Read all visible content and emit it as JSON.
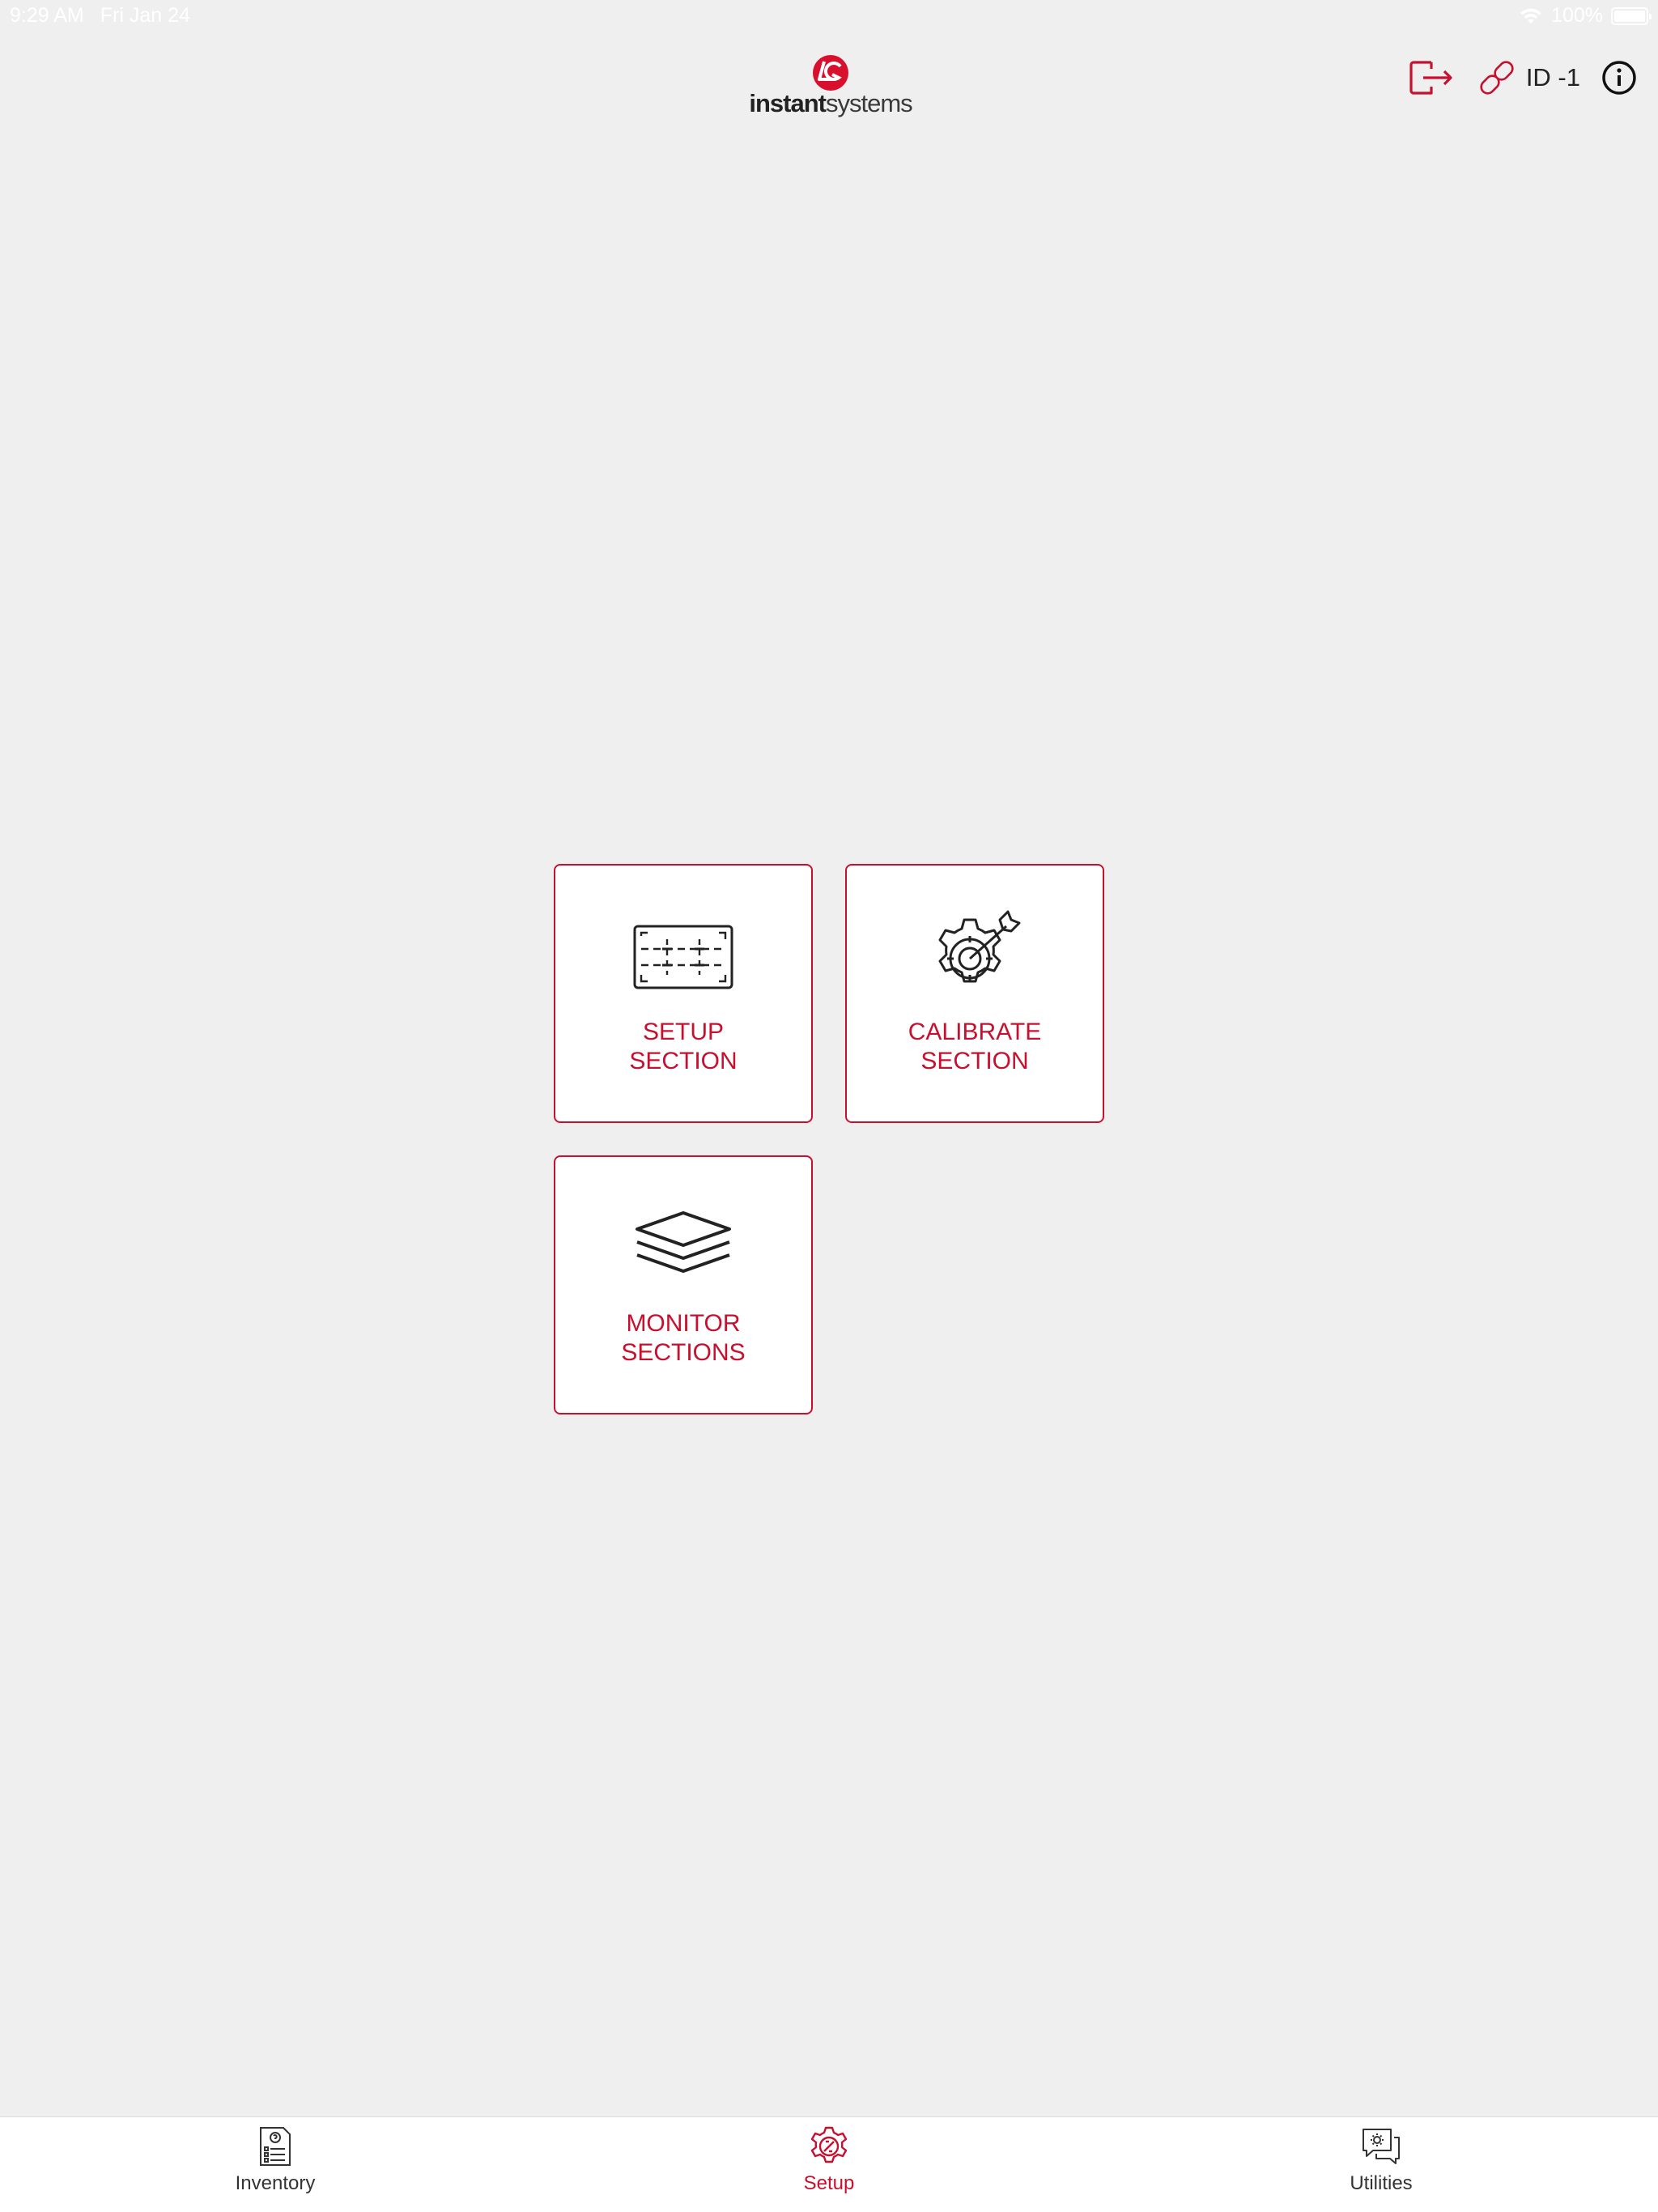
{
  "status_bar": {
    "time": "9:29 AM",
    "date": "Fri Jan 24",
    "battery": "100%",
    "battery_level": 1.0
  },
  "header": {
    "logo": {
      "text_bold": "instant",
      "text_regular": "systems",
      "icon": "instant-systems-logo-icon"
    },
    "logout_icon": "logout-icon",
    "link_icon": "link-icon",
    "id_label": "ID -1",
    "info_icon": "info-icon"
  },
  "tiles": [
    {
      "id": "setup",
      "line1": "SETUP",
      "line2": "SECTION",
      "icon": "grid-layout-icon"
    },
    {
      "id": "calibrate",
      "line1": "CALIBRATE",
      "line2": "SECTION",
      "icon": "gear-target-icon"
    },
    {
      "id": "monitor",
      "line1": "MONITOR",
      "line2": "SECTIONS",
      "icon": "layers-icon"
    }
  ],
  "tab_bar": {
    "tabs": [
      {
        "label": "Inventory",
        "icon": "inventory-document-icon",
        "active": false
      },
      {
        "label": "Setup",
        "icon": "setup-gear-icon",
        "active": true
      },
      {
        "label": "Utilities",
        "icon": "utilities-chat-gear-icon",
        "active": false
      }
    ]
  },
  "colors": {
    "accent": "#c8102e",
    "background": "#efefef",
    "tile_background": "#ffffff",
    "icon_dark": "#222222"
  }
}
